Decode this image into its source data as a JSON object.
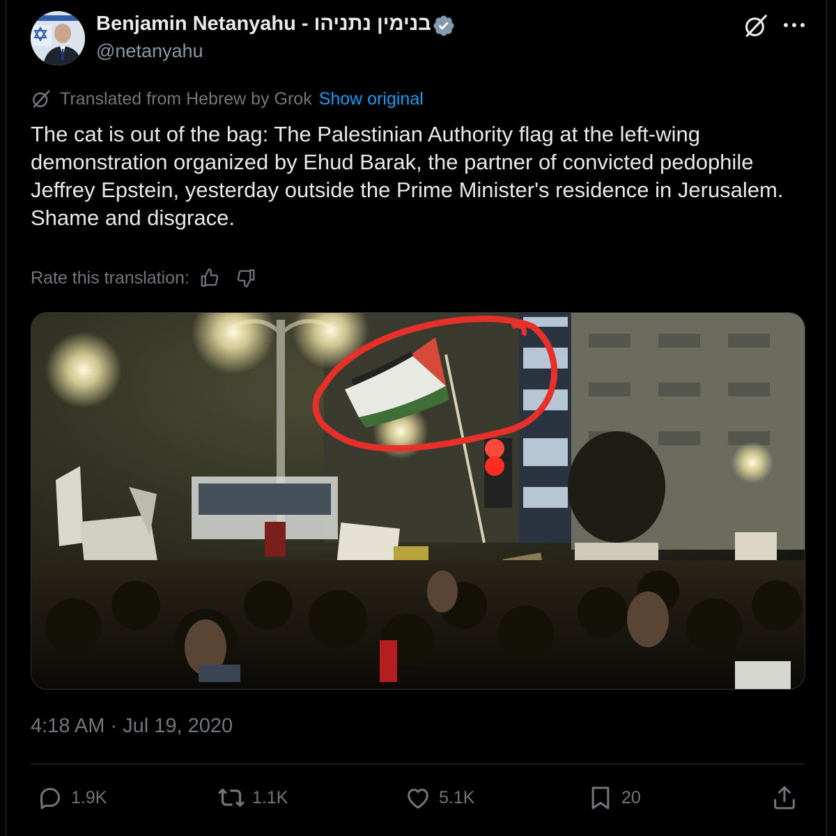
{
  "author": {
    "name": "Benjamin Netanyahu - בנימין נתניהו",
    "handle": "@netanyahu",
    "verified": true
  },
  "header_icons": [
    "grok-icon",
    "more-icon"
  ],
  "translation": {
    "note": "Translated from Hebrew by Grok",
    "show_original_label": "Show original",
    "rate_label": "Rate this translation:"
  },
  "tweet": {
    "text": "The cat is out of the bag: The Palestinian Authority flag at the left-wing demonstration organized by Ehud Barak, the partner of convicted pedophile Jeffrey Epstein, yesterday outside the Prime Minister's residence in Jerusalem. Shame and disgrace.",
    "timestamp": "4:18 AM · Jul 19, 2020"
  },
  "actions": {
    "replies": "1.9K",
    "reposts": "1.1K",
    "likes": "5.1K",
    "bookmarks": "20"
  },
  "colors": {
    "background": "#000000",
    "text_primary": "#e7e9ea",
    "text_secondary": "#71767b",
    "link": "#1d9bf0",
    "verified_badge": "#829aab",
    "annotation_circle": "#e8302a"
  }
}
